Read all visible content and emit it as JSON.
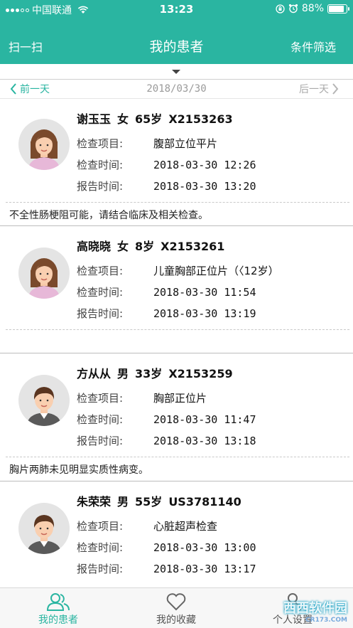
{
  "status_bar": {
    "carrier": "中国联通",
    "time": "13:23",
    "battery": "88%",
    "battery_level": 0.88
  },
  "nav": {
    "scan": "扫一扫",
    "title": "我的患者",
    "filter": "条件筛选"
  },
  "date_bar": {
    "prev": "前一天",
    "date": "2018/03/30",
    "next": "后一天"
  },
  "labels": {
    "exam_item": "检查项目:",
    "exam_time": "检查时间:",
    "report_time": "报告时间:"
  },
  "patients": [
    {
      "name": "谢玉玉",
      "gender": "女",
      "age": "65岁",
      "id": "X2153263",
      "exam_item": "腹部立位平片",
      "exam_time": "2018-03-30 12:26",
      "report_time": "2018-03-30 13:20",
      "diagnosis": "不全性肠梗阻可能，请结合临床及相关检查。"
    },
    {
      "name": "高晓晓",
      "gender": "女",
      "age": "8岁",
      "id": "X2153261",
      "exam_item": "儿童胸部正位片（〈12岁）",
      "exam_time": "2018-03-30 11:54",
      "report_time": "2018-03-30 13:19",
      "diagnosis": ""
    },
    {
      "name": "方从从",
      "gender": "男",
      "age": "33岁",
      "id": "X2153259",
      "exam_item": "胸部正位片",
      "exam_time": "2018-03-30 11:47",
      "report_time": "2018-03-30 13:18",
      "diagnosis": "胸片两肺未见明显实质性病变。"
    },
    {
      "name": "朱荣荣",
      "gender": "男",
      "age": "55岁",
      "id": "US3781140",
      "exam_item": "心脏超声检查",
      "exam_time": "2018-03-30 13:00",
      "report_time": "2018-03-30 13:17",
      "diagnosis": ""
    }
  ],
  "tabs": [
    {
      "label": "我的患者",
      "icon": "patients-icon",
      "active": true
    },
    {
      "label": "我的收藏",
      "icon": "heart-icon",
      "active": false
    },
    {
      "label": "个人设置",
      "icon": "settings-icon",
      "active": false
    }
  ],
  "watermark": {
    "text": "西西软件园",
    "sub": "CR173.COM"
  },
  "colors": {
    "accent": "#2ab5a1",
    "header_bg": "#2ab5a1",
    "tabbar_bg": "#f7f7f7"
  }
}
